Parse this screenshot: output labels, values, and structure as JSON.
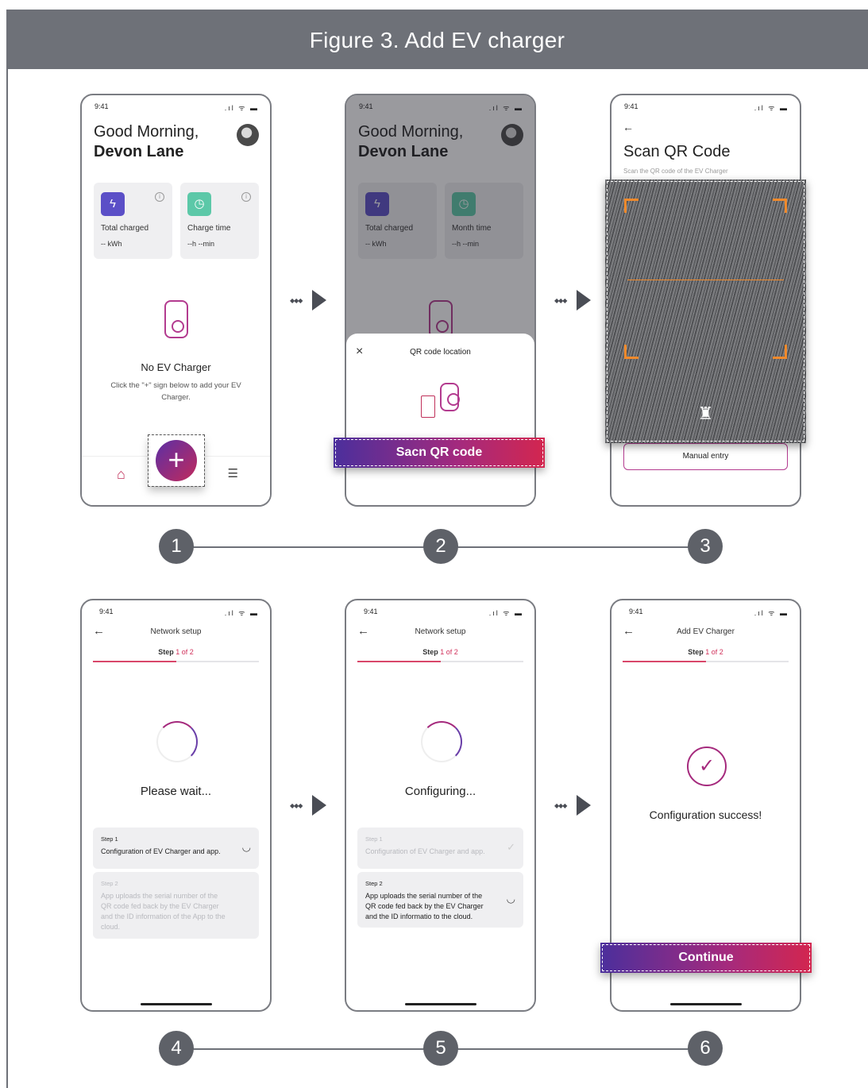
{
  "figure_title": "Figure 3.  Add EV charger",
  "status_time": "9:41",
  "status_icons": ".ıl ᯤ ▬",
  "steps": [
    "1",
    "2",
    "3",
    "4",
    "5",
    "6"
  ],
  "screen1": {
    "greeting": "Good Morning,",
    "name": "Devon Lane",
    "card1_label": "Total charged",
    "card1_value": "-- kWh",
    "card2_label": "Charge time",
    "card2_value": "--h --min",
    "empty_title": "No EV Charger",
    "empty_desc": "Click the \"+\" sign below to add your EV Charger.",
    "add_icon": "+",
    "info_icon": "i",
    "bolt_icon": "ϟ",
    "clock_icon": "◷",
    "home_icon": "⌂",
    "chat_icon": "☰"
  },
  "screen2": {
    "greeting": "Good Morning,",
    "name": "Devon Lane",
    "card1_label": "Total charged",
    "card1_value": "-- kWh",
    "card2_label": "Month time",
    "card2_value": "--h --min",
    "sheet_title": "QR code location",
    "close_icon": "×",
    "button": "Sacn QR code"
  },
  "screen3": {
    "back_icon": "←",
    "title": "Scan QR Code",
    "subtitle": "Scan the QR code of the EV Charger",
    "flashlight_icon": "♜",
    "manual": "Manual entry"
  },
  "screen4": {
    "title": "Network setup",
    "step_prefix": "Step ",
    "step_suffix": "1 of 2",
    "status": "Please wait...",
    "s1_head": "Step 1",
    "s1_text": "Configuration of EV Charger and app.",
    "s2_head": "Step 2",
    "s2_text": "App uploads the serial number of the QR code fed back by the EV Charger and the ID information of the App to the cloud.",
    "loading_icon": "◡"
  },
  "screen5": {
    "title": "Network setup",
    "step_prefix": "Step ",
    "step_suffix": "1 of 2",
    "status": "Configuring...",
    "s1_head": "Step 1",
    "s1_text": "Configuration of EV Charger and app.",
    "s2_head": "Step 2",
    "s2_text": "App uploads the serial number of the QR code fed back by the EV Charger and the ID informatio to the cloud.",
    "check_icon": "✓",
    "loading_icon": "◡"
  },
  "screen6": {
    "title": "Add EV Charger",
    "step_prefix": "Step ",
    "step_suffix": "1 of 2",
    "status": "Configuration success!",
    "success_icon": "✓",
    "button": "Continue"
  },
  "colors": {
    "accent": "#a52a7d",
    "progress": "#d9476a",
    "purple": "#5b4fc7",
    "teal": "#5cc8a8",
    "scan_corner": "#f08a2c"
  }
}
